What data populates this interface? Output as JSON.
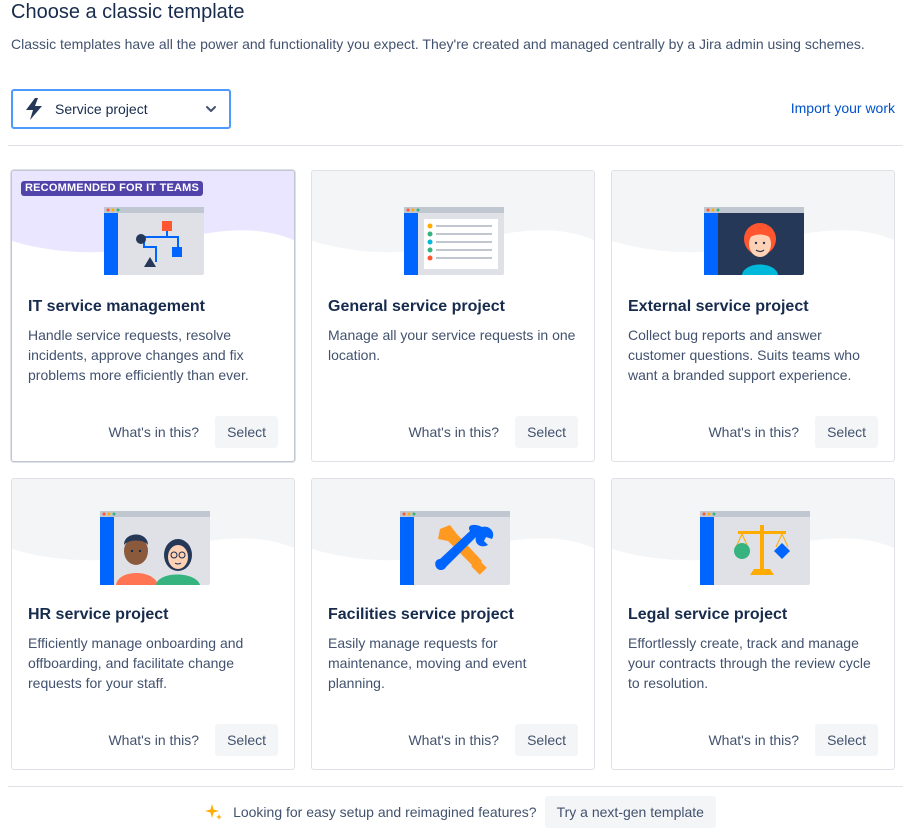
{
  "header": {
    "title": "Choose a classic template",
    "description": "Classic templates have all the power and functionality you expect. They're created and managed centrally by a Jira admin using schemes."
  },
  "project_type_select": {
    "selected": "Service project",
    "icon": "service-project-bolt-icon"
  },
  "import_link": "Import your work",
  "cards": [
    {
      "badge": "RECOMMENDED FOR IT TEAMS",
      "title": "IT service management",
      "description": "Handle service requests, resolve incidents, approve changes and fix problems more efficiently than ever.",
      "whats_in": "What's in this?",
      "select": "Select"
    },
    {
      "title": "General service project",
      "description": "Manage all your service requests in one location.",
      "whats_in": "What's in this?",
      "select": "Select"
    },
    {
      "title": "External service project",
      "description": "Collect bug reports and answer customer questions. Suits teams who want a branded support experience.",
      "whats_in": "What's in this?",
      "select": "Select"
    },
    {
      "title": "HR service project",
      "description": "Efficiently manage onboarding and offboarding, and facilitate change requests for your staff.",
      "whats_in": "What's in this?",
      "select": "Select"
    },
    {
      "title": "Facilities service project",
      "description": "Easily manage requests for maintenance, moving and event planning.",
      "whats_in": "What's in this?",
      "select": "Select"
    },
    {
      "title": "Legal service project",
      "description": "Effortlessly create, track and manage your contracts through the review cycle to resolution.",
      "whats_in": "What's in this?",
      "select": "Select"
    }
  ],
  "footer": {
    "text": "Looking for easy setup and reimagined features?",
    "button": "Try a next-gen template"
  },
  "colors": {
    "link": "#0052cc",
    "badge": "#5243aa",
    "featured_tint": "#eae6ff",
    "focus_border": "#4c9aff",
    "text_primary": "#172b4d",
    "text_secondary": "#42526e"
  }
}
